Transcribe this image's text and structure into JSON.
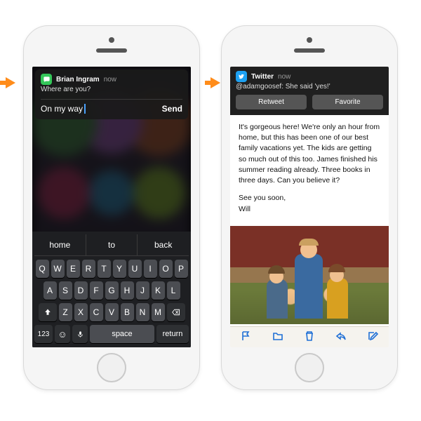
{
  "left": {
    "notif": {
      "app_name": "Brian Ingram",
      "time": "now",
      "subtitle": "Where are you?",
      "reply_text": "On my way",
      "send_label": "Send"
    },
    "keyboard": {
      "suggestions": [
        "home",
        "to",
        "back"
      ],
      "row1": [
        "Q",
        "W",
        "E",
        "R",
        "T",
        "Y",
        "U",
        "I",
        "O",
        "P"
      ],
      "row2": [
        "A",
        "S",
        "D",
        "F",
        "G",
        "H",
        "J",
        "K",
        "L"
      ],
      "row3": [
        "Z",
        "X",
        "C",
        "V",
        "B",
        "N",
        "M"
      ],
      "num_key": "123",
      "space_key": "space",
      "return_key": "return"
    }
  },
  "right": {
    "notif": {
      "app_name": "Twitter",
      "time": "now",
      "subtitle": "@adamgoosef: She said 'yes!'",
      "retweet_label": "Retweet",
      "favorite_label": "Favorite"
    },
    "mail": {
      "para1": "It's gorgeous here! We're only an hour from home, but this has been one of our best family vacations yet. The kids are getting so much out of this too. James finished his summer reading already. Three books in three days. Can you believe it?",
      "signoff1": "See you soon,",
      "signoff2": "Will"
    },
    "toolbar_icons": [
      "flag",
      "folder",
      "trash",
      "reply",
      "compose"
    ]
  }
}
